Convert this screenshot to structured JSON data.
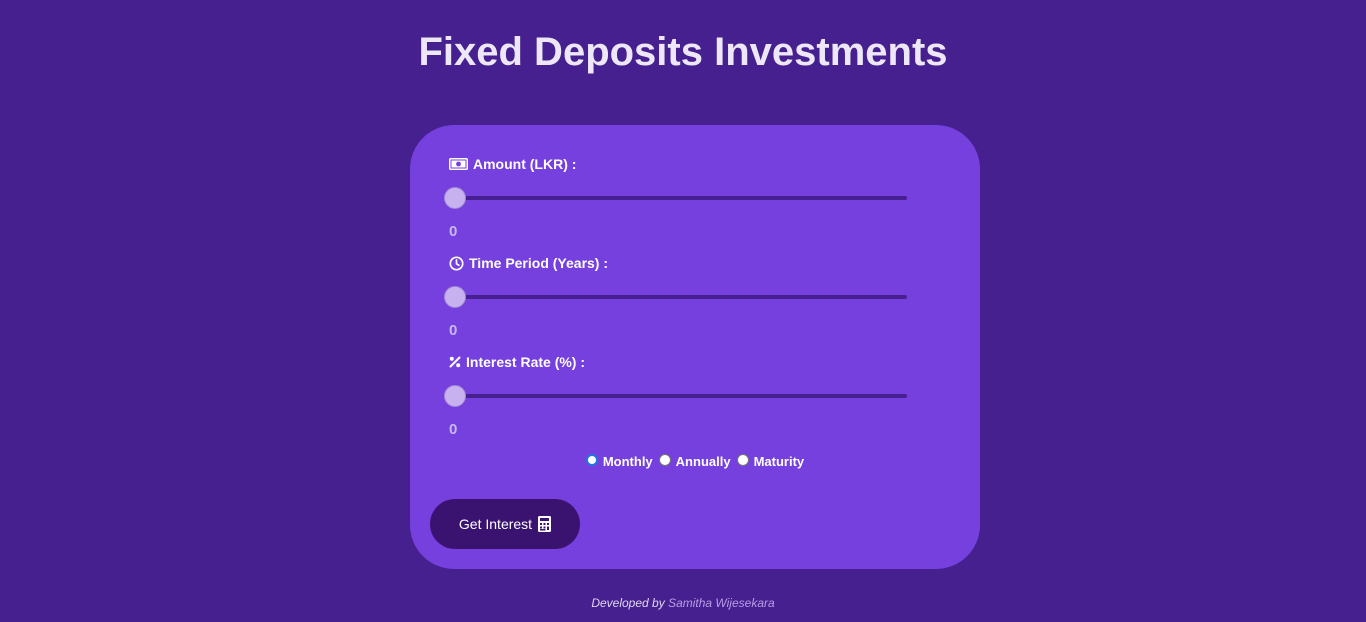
{
  "header": {
    "title": "Fixed Deposits Investments"
  },
  "form": {
    "amount": {
      "icon": "money-bill-icon",
      "label": "Amount (LKR) :",
      "value": "0",
      "slider_value": 0
    },
    "period": {
      "icon": "clock-icon",
      "label": "Time Period (Years) :",
      "value": "0",
      "slider_value": 0
    },
    "rate": {
      "icon": "percent-icon",
      "label": "Interest Rate (%) :",
      "value": "0",
      "slider_value": 0
    },
    "payout": {
      "options": [
        "Monthly",
        "Annually",
        "Maturity"
      ],
      "selected": "Monthly"
    },
    "submit_label": "Get Interest",
    "submit_icon": "calculator-icon"
  },
  "footer": {
    "prefix": "Developed by",
    "author": "Samitha Wijesekara"
  },
  "colors": {
    "background": "#45208e",
    "card": "#7540dd",
    "button": "#3a1371",
    "slider_thumb": "#c7b2ef"
  }
}
